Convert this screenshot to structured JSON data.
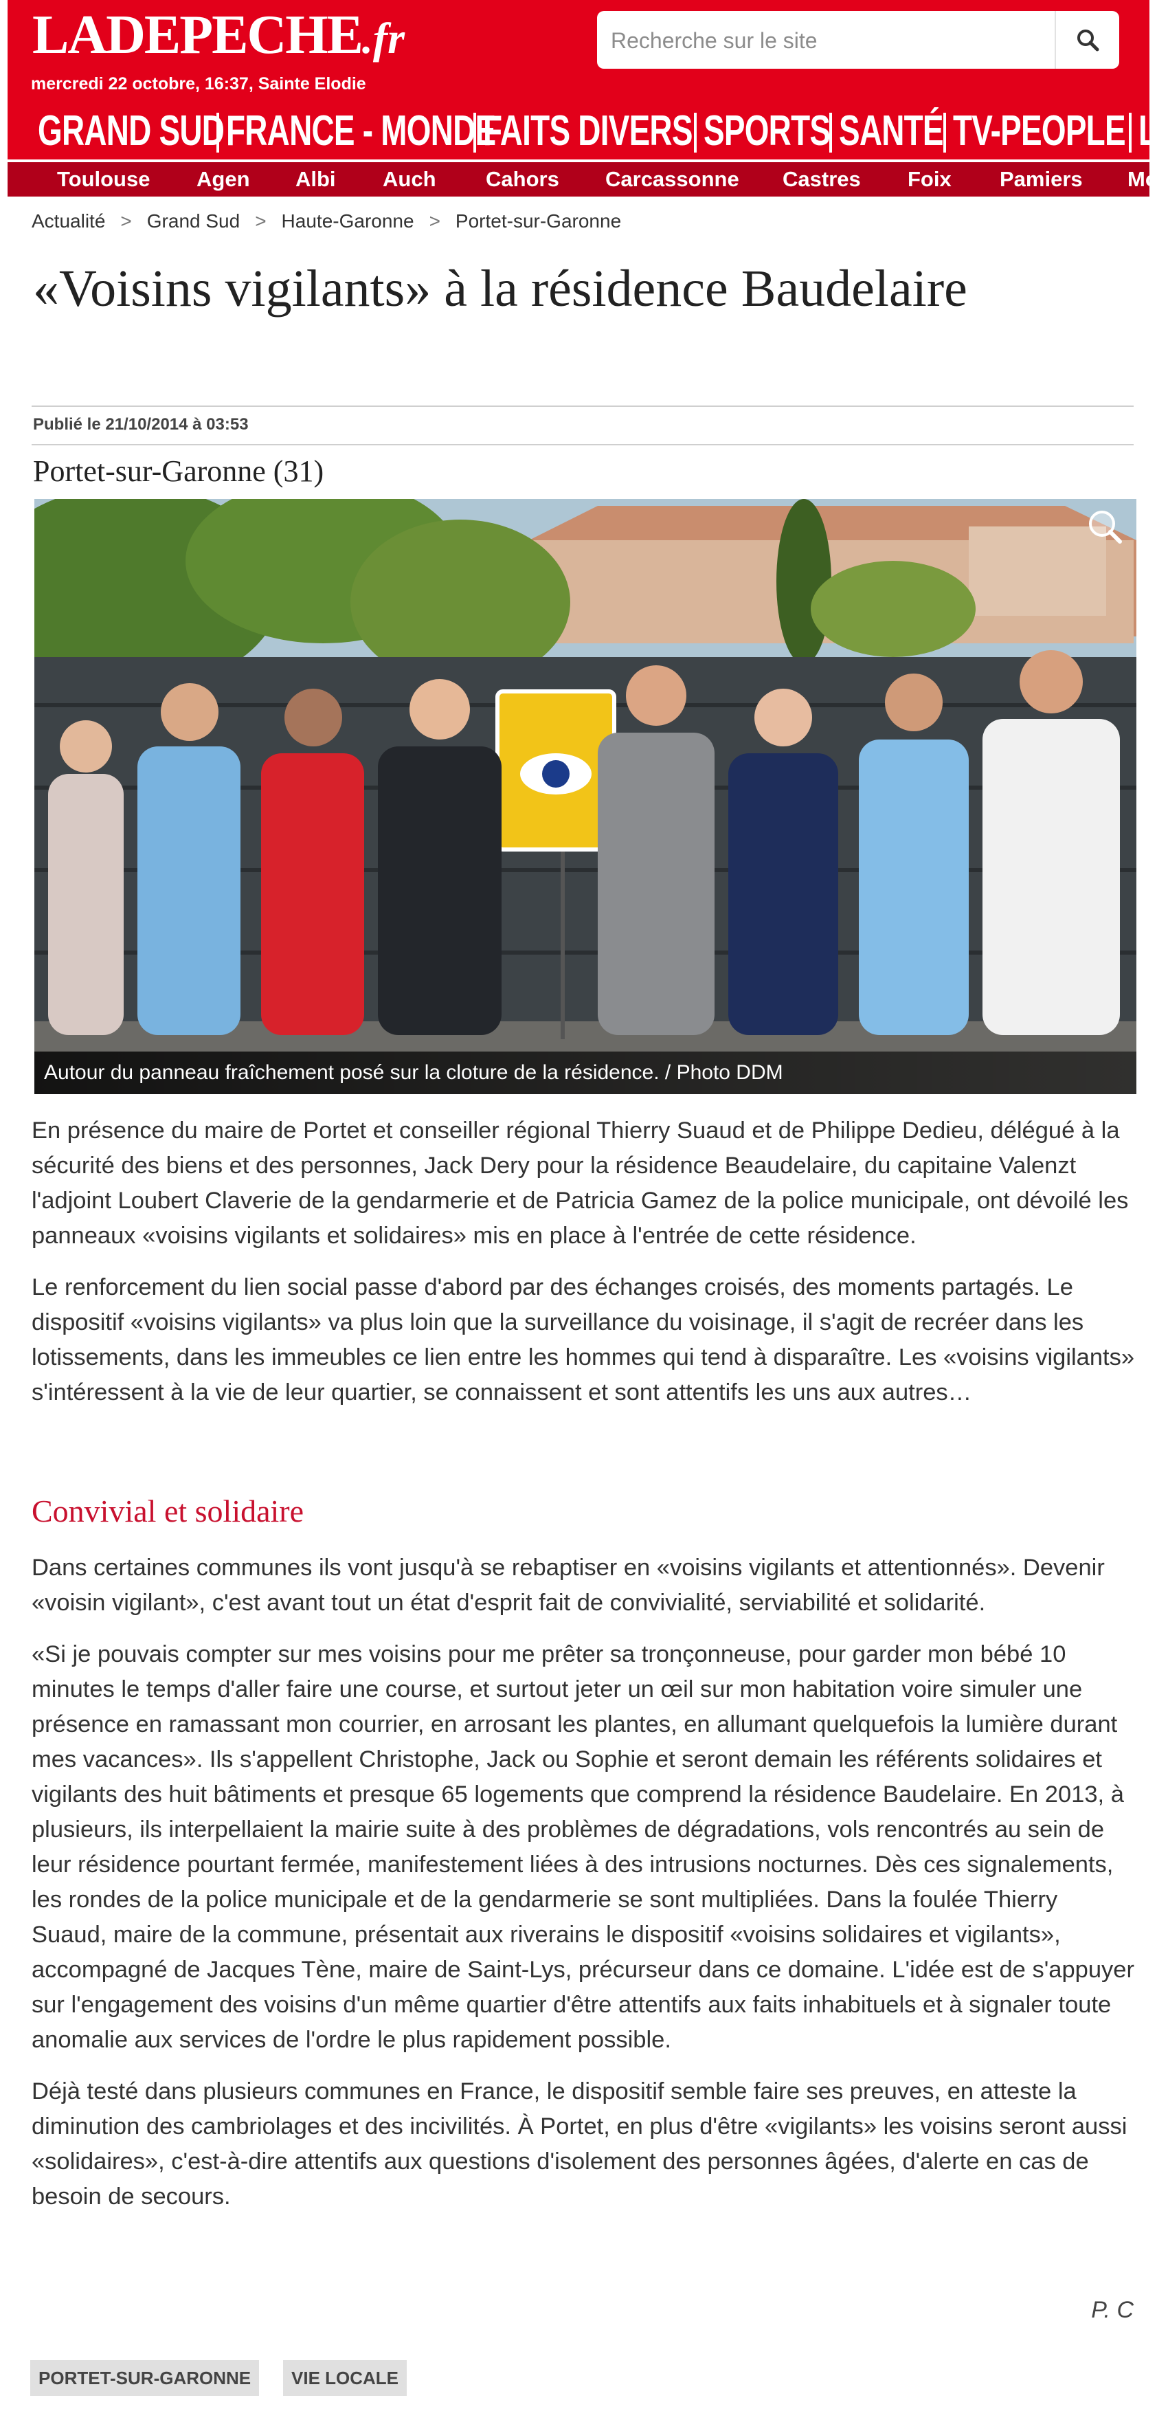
{
  "site": {
    "logo_main": "LADEPECHE",
    "logo_dot_fr": ".fr",
    "dateline": "mercredi 22 octobre, 16:37, Sainte Elodie"
  },
  "search": {
    "placeholder": "Recherche sur le site",
    "icon": "search-icon"
  },
  "main_nav": [
    "GRAND SUD",
    "FRANCE - MONDE",
    "FAITS DIVERS",
    "SPORTS",
    "SANTÉ",
    "TV-PEOPLE",
    "L"
  ],
  "sub_nav": [
    "Toulouse",
    "Agen",
    "Albi",
    "Auch",
    "Cahors",
    "Carcassonne",
    "Castres",
    "Foix",
    "Pamiers",
    "Mo"
  ],
  "breadcrumb": [
    "Actualité",
    "Grand Sud",
    "Haute-Garonne",
    "Portet-sur-Garonne"
  ],
  "breadcrumb_separator": ">",
  "article": {
    "title": "«Voisins vigilants» à la résidence Baudelaire",
    "published": "Publié le 21/10/2014 à 03:53",
    "location": "Portet-sur-Garonne (31)",
    "photo_caption": "Autour du panneau fraîchement posé sur la cloture de la résidence. / Photo DDM",
    "paragraphs_intro": [
      "En présence du maire de Portet et conseiller régional Thierry Suaud et de Philippe Dedieu, délégué à la sécurité des biens et des personnes, Jack Dery pour la résidence Beaudelaire, du capitaine Valenzt l'adjoint Loubert Claverie de la gendarmerie et de Patricia Gamez de la police municipale, ont dévoilé les panneaux «voisins vigilants et solidaires» mis en place à l'entrée de cette résidence.",
      "Le renforcement du lien social passe d'abord par des échanges croisés, des moments partagés. Le dispositif «voisins vigilants» va plus loin que la surveillance du voisinage, il s'agit de recréer dans les lotissements, dans les immeubles ce lien entre les hommes qui tend à disparaître. Les «voisins vigilants» s'intéressent à la vie de leur quartier, se connaissent et sont attentifs les uns aux autres…"
    ],
    "subheading": "Convivial et solidaire",
    "paragraphs_after": [
      "Dans certaines communes ils vont jusqu'à se rebaptiser en «voisins vigilants et attentionnés». Devenir «voisin vigilant», c'est avant tout un état d'esprit fait de convivialité, serviabilité et solidarité.",
      "«Si je pouvais compter sur mes voisins pour me prêter sa tronçonneuse, pour garder mon bébé 10 minutes le temps d'aller faire une course, et surtout jeter un œil sur mon habitation voire simuler une présence en ramassant mon courrier, en arrosant les plantes, en allumant quelquefois la lumière durant mes vacances». Ils s'appellent Christophe, Jack ou Sophie et seront demain les référents solidaires et vigilants des huit bâtiments et presque 65 logements que comprend la résidence Baudelaire. En 2013, à plusieurs, ils interpellaient la mairie suite à des problèmes de dégradations, vols rencontrés au sein de leur résidence pourtant fermée, manifestement liées à des intrusions nocturnes. Dès ces signalements, les rondes de la police municipale et de la gendarmerie se sont multipliées. Dans la foulée Thierry Suaud, maire de la commune, présentait aux riverains le dispositif «voisins solidaires et vigilants», accompagné de Jacques Tène, maire de Saint-Lys, précurseur dans ce domaine. L'idée est de s'appuyer sur l'engagement des voisins d'un même quartier d'être attentifs aux faits inhabituels et à signaler toute anomalie aux services de l'ordre le plus rapidement possible.",
      "Déjà testé dans plusieurs communes en France, le dispositif semble faire ses preuves, en atteste la diminution des cambriolages et des incivilités. À Portet, en plus d'être «vigilants» les voisins seront aussi «solidaires», c'est-à-dire attentifs aux questions d'isolement des personnes âgées, d'alerte en cas de besoin de secours."
    ],
    "author": "P. C",
    "tags": [
      "PORTET-SUR-GARONNE",
      "VIE LOCALE"
    ]
  },
  "colors": {
    "brand_red": "#e2001a",
    "subnav_red": "#b0001a",
    "subheading_red": "#c8102e",
    "tag_bg": "#e0e0e0"
  }
}
